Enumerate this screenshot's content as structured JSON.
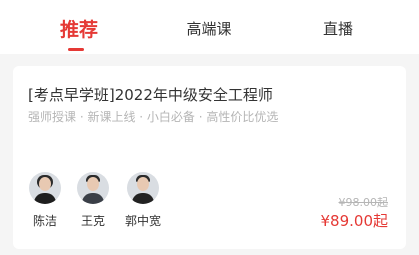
{
  "tabs": [
    {
      "label": "推荐",
      "active": true
    },
    {
      "label": "高端课",
      "active": false
    },
    {
      "label": "直播",
      "active": false
    }
  ],
  "course": {
    "title": "[考点早学班]2022年中级安全工程师",
    "subtitle": "强师授课 · 新课上线 · 小白必备 · 高性价比优选",
    "teachers": [
      {
        "name": "陈洁",
        "avatar": "teacher-avatar-female"
      },
      {
        "name": "王克",
        "avatar": "teacher-avatar-male"
      },
      {
        "name": "郭中宽",
        "avatar": "teacher-avatar-male"
      }
    ],
    "original_price": "¥98.00起",
    "price": "¥89.00起"
  },
  "colors": {
    "accent": "#e53935",
    "muted": "#b5b5b5",
    "text": "#333333",
    "background": "#f5f5f5"
  }
}
